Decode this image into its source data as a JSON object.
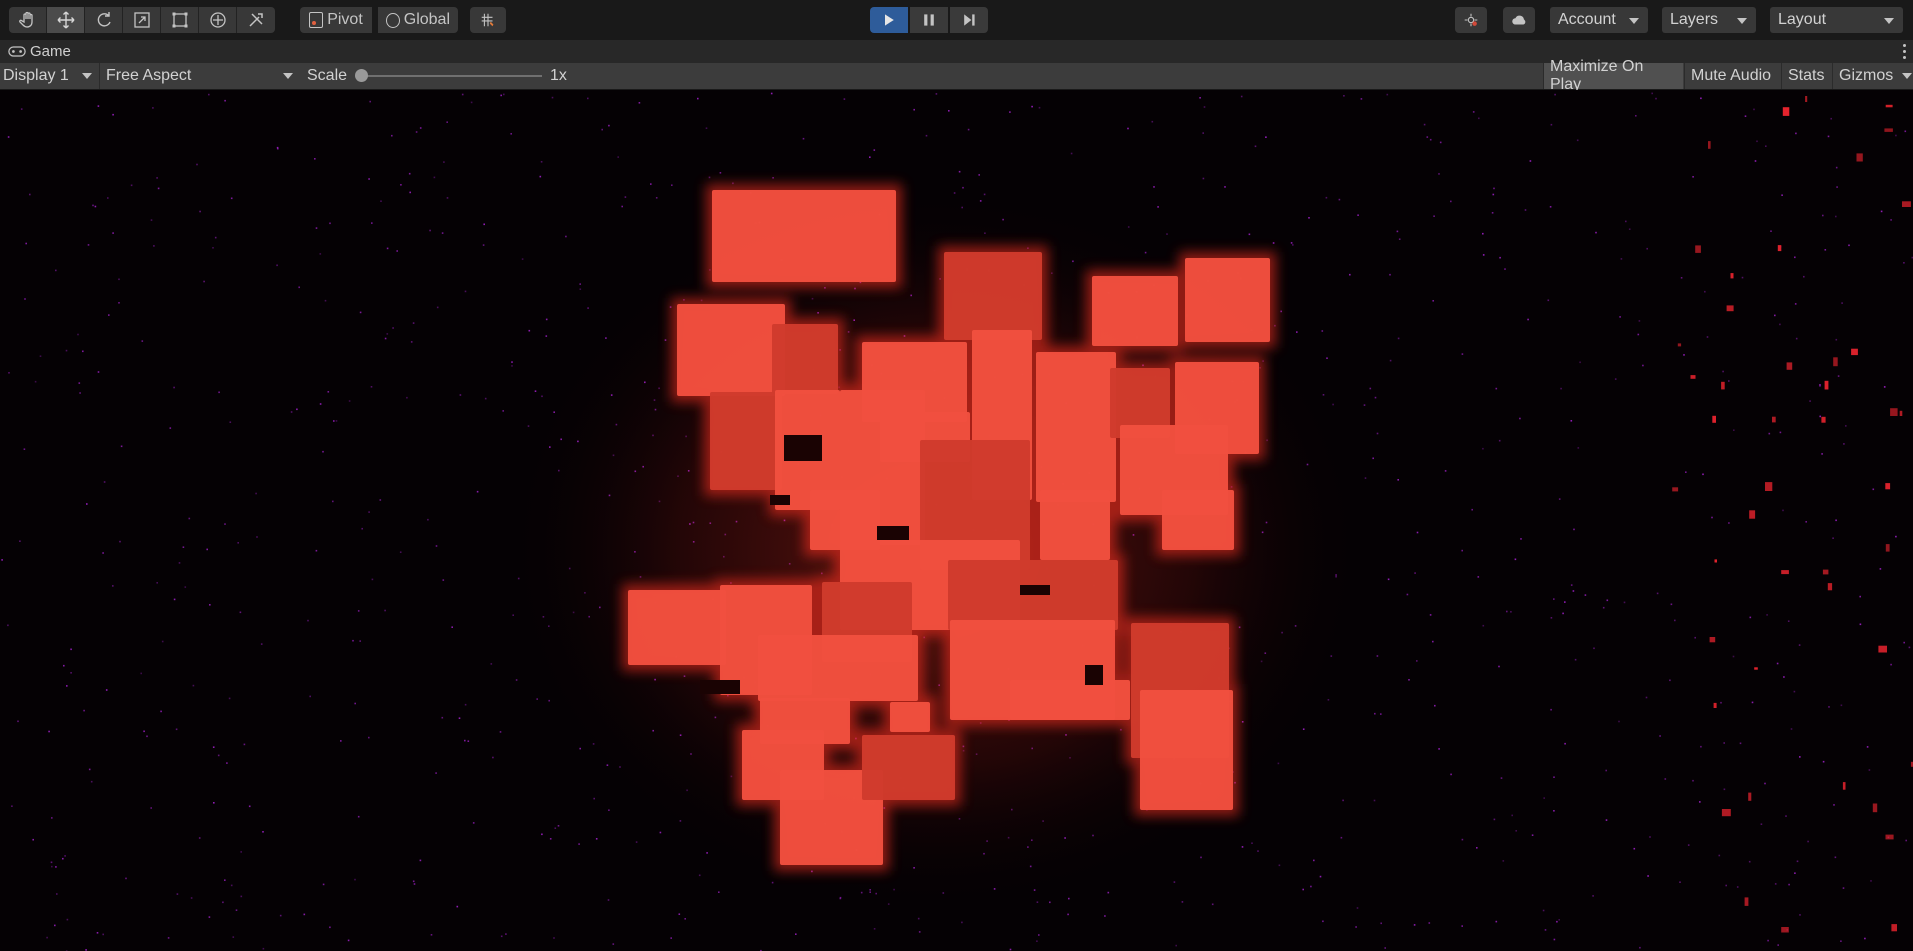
{
  "toolbar": {
    "tools": [
      {
        "icon": "hand-tool-icon"
      },
      {
        "icon": "move-tool-icon",
        "active": true
      },
      {
        "icon": "rotate-tool-icon"
      },
      {
        "icon": "scale-tool-icon"
      },
      {
        "icon": "rect-tool-icon"
      },
      {
        "icon": "transform-tool-icon"
      },
      {
        "icon": "custom-tool-icon"
      }
    ],
    "pivot_label": "Pivot",
    "global_label": "Global",
    "snap_icon": "grid-snap-icon",
    "play": {
      "icon": "play-icon",
      "active": true
    },
    "pause": {
      "icon": "pause-icon"
    },
    "step": {
      "icon": "step-icon"
    },
    "collab_icon": "collab-icon",
    "cloud_icon": "cloud-icon",
    "account_label": "Account",
    "layers_label": "Layers",
    "layout_label": "Layout"
  },
  "tab": {
    "icon": "gamepad-icon",
    "label": "Game"
  },
  "game_bar": {
    "display_label": "Display 1",
    "aspect_label": "Free Aspect",
    "scale_label": "Scale",
    "scale_value": "1x",
    "scale_level": 0,
    "maximize_label": "Maximize On Play",
    "mute_label": "Mute Audio",
    "stats_label": "Stats",
    "gizmos_label": "Gizmos"
  },
  "colors": {
    "cube": "#f1503f",
    "cube_dark": "#cf3b2c",
    "particles": "#a020c8",
    "particles_red": "#e8232e",
    "play_active": "#2e5c9a"
  }
}
